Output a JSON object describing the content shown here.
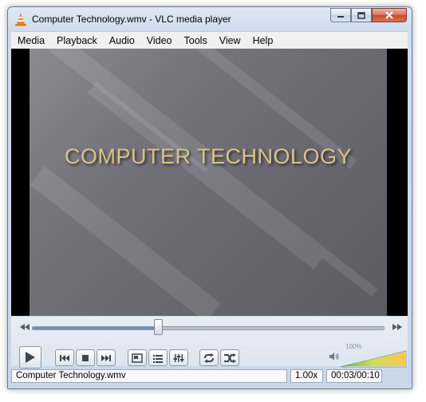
{
  "window": {
    "title": "Computer Technology.wmv - VLC media player",
    "icon": "vlc-cone-icon"
  },
  "caption_buttons": [
    "minimize-icon",
    "maximize-icon",
    "close-icon"
  ],
  "menu": {
    "items": [
      "Media",
      "Playback",
      "Audio",
      "Video",
      "Tools",
      "View",
      "Help"
    ]
  },
  "video": {
    "slide_title": "COMPUTER TECHNOLOGY",
    "colors": {
      "text": "#d8c489",
      "background": "#75747c"
    }
  },
  "seek": {
    "position_fraction": 0.36,
    "left_icon": "slower-icon",
    "right_icon": "faster-icon"
  },
  "controls": {
    "buttons": [
      {
        "name": "play-button",
        "icon": "play-icon"
      },
      {
        "name": "previous-button",
        "icon": "previous-icon"
      },
      {
        "name": "stop-button",
        "icon": "stop-icon"
      },
      {
        "name": "next-button",
        "icon": "next-icon"
      },
      {
        "name": "fullscreen-button",
        "icon": "fullscreen-icon"
      },
      {
        "name": "playlist-button",
        "icon": "playlist-icon"
      },
      {
        "name": "extended-settings-button",
        "icon": "equalizer-icon"
      },
      {
        "name": "loop-button",
        "icon": "loop-icon"
      },
      {
        "name": "shuffle-button",
        "icon": "shuffle-icon"
      }
    ]
  },
  "volume": {
    "percent_label": "100%",
    "level": 1.0,
    "icon": "speaker-icon"
  },
  "status": {
    "filename": "Computer Technology.wmv",
    "speed": "1.00x",
    "time": "00:03/00:10"
  }
}
